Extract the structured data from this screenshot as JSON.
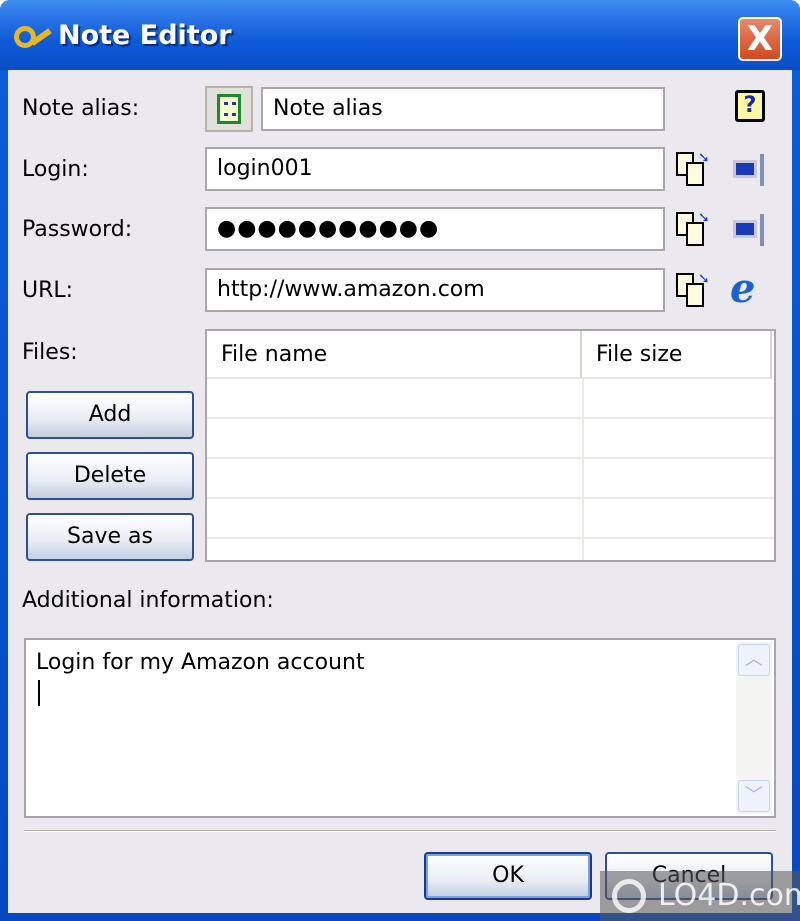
{
  "window": {
    "title": "Note Editor",
    "close_label": "X"
  },
  "fields": {
    "alias": {
      "label": "Note alias:",
      "value": "Note alias"
    },
    "login": {
      "label": "Login:",
      "value": "login001"
    },
    "password": {
      "label": "Password:",
      "value": "●●●●●●●●●●●"
    },
    "url": {
      "label": "URL:",
      "value": "http://www.amazon.com"
    }
  },
  "files": {
    "label": "Files:",
    "add": "Add",
    "delete": "Delete",
    "save_as": "Save as",
    "columns": [
      "File name",
      "File size"
    ]
  },
  "additional": {
    "label": "Additional information:",
    "value": "Login for my Amazon account"
  },
  "buttons": {
    "ok": "OK",
    "cancel": "Cancel"
  },
  "watermark": "LO4D.com"
}
